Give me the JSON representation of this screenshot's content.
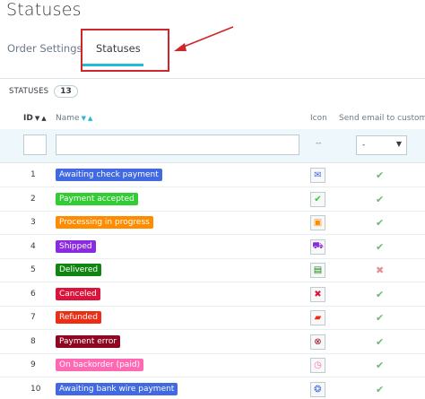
{
  "page": {
    "title": "Statuses"
  },
  "tabs": [
    {
      "label": "Order Settings"
    },
    {
      "label": "Statuses"
    }
  ],
  "panel": {
    "label": "STATUSES",
    "count": "13"
  },
  "columns": {
    "id": "ID",
    "name": "Name",
    "icon": "Icon",
    "email": "Send email to customer"
  },
  "filters": {
    "icon_placeholder": "--",
    "email_select": "-"
  },
  "colors": {
    "accent": "#25b9d7",
    "highlight_box": "#d0252b"
  },
  "rows": [
    {
      "id": "1",
      "name": "Awaiting check payment",
      "color": "#4169e1",
      "icon": "envelope-icon",
      "glyph": "✉",
      "email": "✔"
    },
    {
      "id": "2",
      "name": "Payment accepted",
      "color": "#32cd32",
      "icon": "check-icon",
      "glyph": "✔",
      "email": "✔"
    },
    {
      "id": "3",
      "name": "Processing in progress",
      "color": "#ff8c00",
      "icon": "package-icon",
      "glyph": "▣",
      "email": "✔"
    },
    {
      "id": "4",
      "name": "Shipped",
      "color": "#8a2be2",
      "icon": "truck-icon",
      "glyph": "⛟",
      "email": "✔"
    },
    {
      "id": "5",
      "name": "Delivered",
      "color": "#108510",
      "icon": "document-icon",
      "glyph": "▤",
      "email": "✖"
    },
    {
      "id": "6",
      "name": "Canceled",
      "color": "#dc143c",
      "icon": "cross-icon",
      "glyph": "✖",
      "email": "✔"
    },
    {
      "id": "7",
      "name": "Refunded",
      "color": "#ec2e15",
      "icon": "money-icon",
      "glyph": "▰",
      "email": "✔"
    },
    {
      "id": "8",
      "name": "Payment error",
      "color": "#8f0621",
      "icon": "error-icon",
      "glyph": "⊗",
      "email": "✔"
    },
    {
      "id": "9",
      "name": "On backorder (paid)",
      "color": "#ff69b4",
      "icon": "clock-icon",
      "glyph": "◷",
      "email": "✔"
    },
    {
      "id": "10",
      "name": "Awaiting bank wire payment",
      "color": "#4169e1",
      "icon": "coins-icon",
      "glyph": "❂",
      "email": "✔"
    }
  ]
}
